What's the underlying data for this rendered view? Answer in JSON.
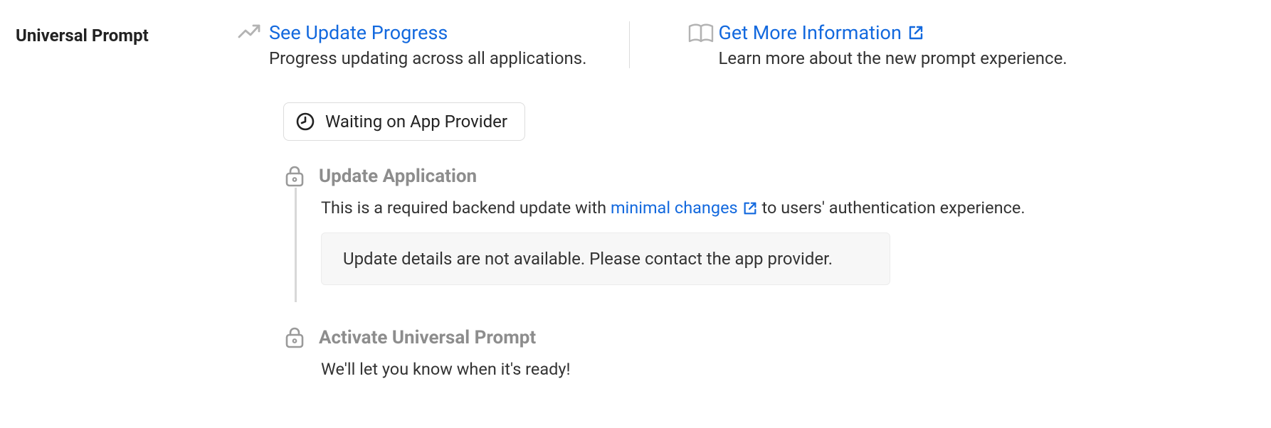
{
  "section_label": "Universal Prompt",
  "top_links": {
    "progress": {
      "title": "See Update Progress",
      "desc": "Progress updating across all applications."
    },
    "info": {
      "title": "Get More Information",
      "desc": "Learn more about the new prompt experience."
    }
  },
  "status_chip": "Waiting on App Provider",
  "steps": {
    "update": {
      "title": "Update Application",
      "desc_before": "This is a required backend update with ",
      "link_text": "minimal changes",
      "desc_after": " to users' authentication experience.",
      "info_box": "Update details are not available. Please contact the app provider."
    },
    "activate": {
      "title": "Activate Universal Prompt",
      "desc": "We'll let you know when it's ready!"
    }
  }
}
